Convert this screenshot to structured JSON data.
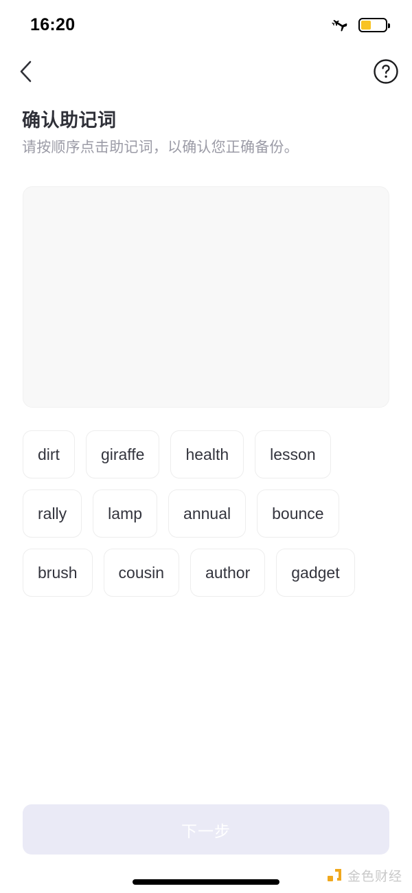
{
  "status_bar": {
    "time": "16:20",
    "airplane_icon": "airplane-icon",
    "battery_icon": "battery-icon",
    "battery_level_percent": 40,
    "battery_color": "#f8c324"
  },
  "nav": {
    "back_icon": "chevron-left-icon",
    "help_icon": "question-circle-icon"
  },
  "header": {
    "title": "确认助记词",
    "subtitle": "请按顺序点击助记词，以确认您正确备份。"
  },
  "answer_area": {
    "selected_words": [],
    "background_color": "#f8f8f8"
  },
  "word_pool": {
    "words": [
      "dirt",
      "giraffe",
      "health",
      "lesson",
      "rally",
      "lamp",
      "annual",
      "bounce",
      "brush",
      "cousin",
      "author",
      "gadget"
    ]
  },
  "footer": {
    "next_label": "下一步",
    "next_enabled": false,
    "next_background_color": "#eaeaf6",
    "next_text_color": "#ffffff"
  },
  "watermark": {
    "text": "金色财经",
    "mark_color": "#f0a81e"
  }
}
